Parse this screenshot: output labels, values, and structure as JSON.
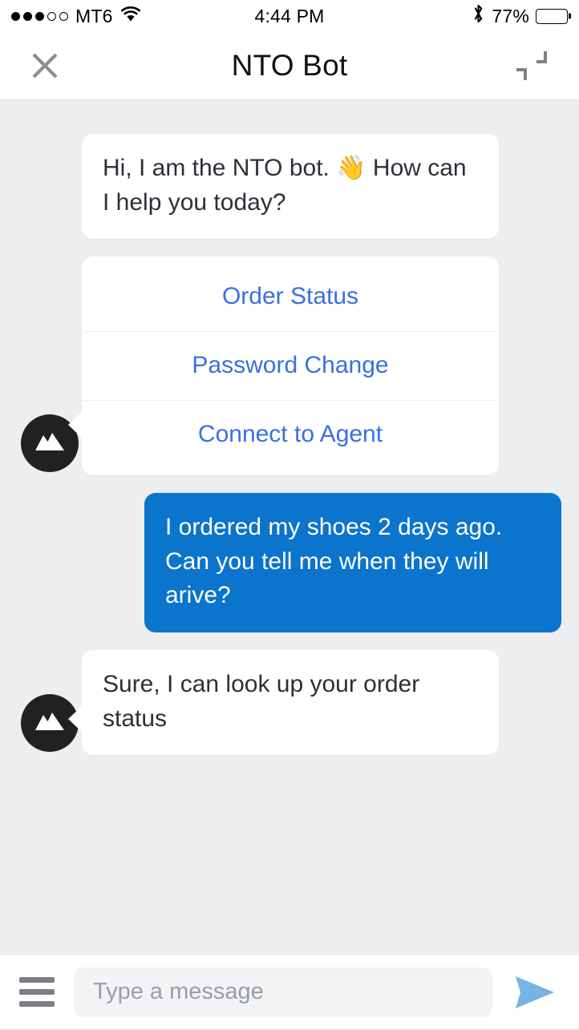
{
  "status_bar": {
    "signal_dots_total": 5,
    "signal_dots_filled": 3,
    "carrier": "MT6",
    "wifi_icon": "wifi-icon",
    "time": "4:44 PM",
    "bluetooth_icon": "bluetooth-icon",
    "battery_percent": "77%",
    "battery_level": 77
  },
  "header": {
    "close_icon": "close-icon",
    "title": "NTO Bot",
    "minimize_icon": "minimize-icon"
  },
  "conversation": {
    "messages": [
      {
        "sender": "bot",
        "type": "text",
        "text": "Hi, I am the NTO bot. 👋 How can I help you today?",
        "show_avatar": false,
        "show_tail": false
      },
      {
        "sender": "bot",
        "type": "options",
        "show_avatar": true,
        "options": [
          {
            "label": "Order Status"
          },
          {
            "label": "Password Change"
          },
          {
            "label": "Connect to Agent"
          }
        ]
      },
      {
        "sender": "user",
        "type": "text",
        "text": "I ordered my shoes 2 days ago. Can you tell me when they will arive?",
        "show_avatar": false,
        "show_tail": false
      },
      {
        "sender": "bot",
        "type": "text",
        "text": "Sure, I can look up your order status",
        "show_avatar": true,
        "show_tail": true
      }
    ],
    "avatar_icon": "mountain-logo-icon"
  },
  "composer": {
    "menu_icon": "hamburger-menu-icon",
    "input_value": "",
    "input_placeholder": "Type a message",
    "send_icon": "send-icon"
  },
  "colors": {
    "background": "#eceef0",
    "user_bubble": "#0b74cc",
    "bot_bubble": "#ffffff",
    "option_text": "#3b6fe0",
    "send_icon": "#77b3e5",
    "avatar_bg": "#212121",
    "header_text": "#111214"
  }
}
